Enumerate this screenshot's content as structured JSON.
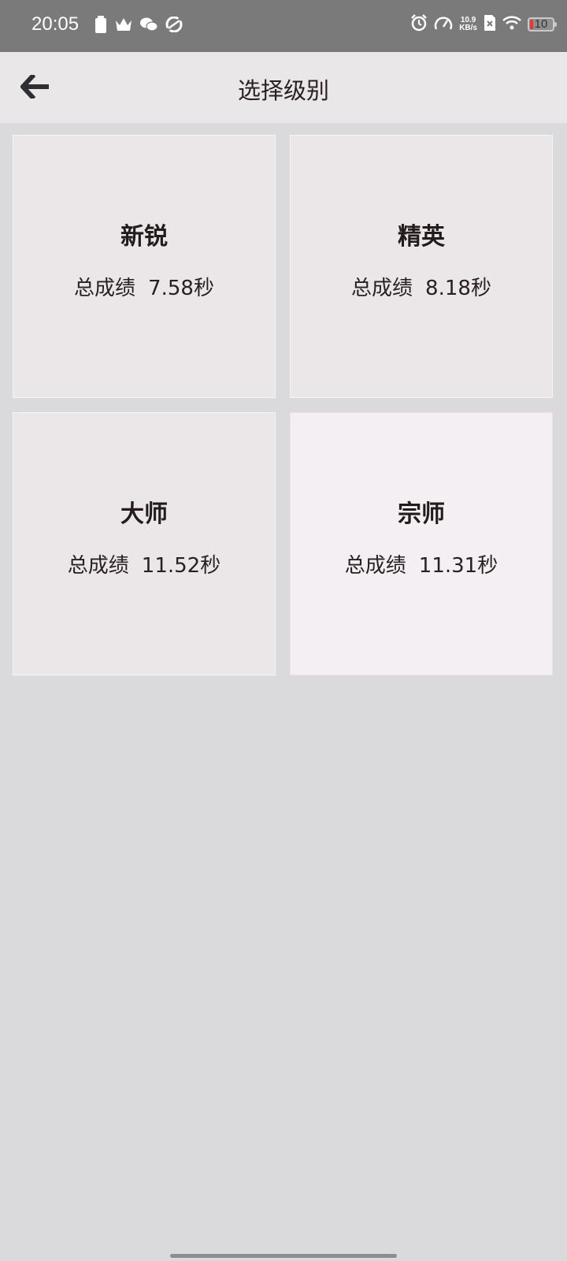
{
  "status_bar": {
    "time": "20:05",
    "left_icons": [
      "battery-saver-icon",
      "crown-icon",
      "wechat-icon",
      "sync-icon"
    ],
    "right_icons": [
      "alarm-icon",
      "speedometer-icon",
      "no-sim-icon",
      "wifi-icon",
      "battery-icon"
    ],
    "net_speed_value": "10.9",
    "net_speed_unit": "KB/s",
    "battery_level": "10"
  },
  "app_bar": {
    "back_icon": "back-arrow-icon",
    "title": "选择级别"
  },
  "levels": [
    {
      "name": "新锐",
      "score_label": "总成绩",
      "score_value": "7.58秒",
      "selected": false
    },
    {
      "name": "精英",
      "score_label": "总成绩",
      "score_value": "8.18秒",
      "selected": false
    },
    {
      "name": "大师",
      "score_label": "总成绩",
      "score_value": "11.52秒",
      "selected": false
    },
    {
      "name": "宗师",
      "score_label": "总成绩",
      "score_value": "11.31秒",
      "selected": true
    }
  ],
  "colors": {
    "background": "#dad9dc",
    "card": "#ebe7e8",
    "card_selected": "#f3eff2",
    "status_bar": "#7a7a7a",
    "app_bar": "#eae7e8",
    "text": "#2a2022"
  }
}
